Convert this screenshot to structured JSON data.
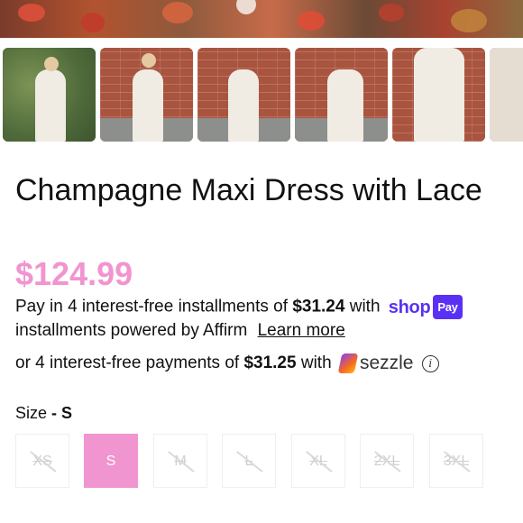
{
  "product": {
    "title": "Champagne Maxi Dress with Lace",
    "price": "$124.99"
  },
  "shop_pay": {
    "line_start": "Pay in 4 interest-free installments of",
    "amount": "$31.24",
    "with": "with",
    "logo_text": "shop",
    "pill_text": "Pay",
    "line_end": "installments powered by Affirm",
    "learn_more": "Learn more"
  },
  "sezzle": {
    "line_start": "or 4 interest-free payments of",
    "amount": "$31.25",
    "with": "with",
    "logo_text": "sezzle",
    "info_glyph": "i"
  },
  "size": {
    "label": "Size",
    "separator": "-",
    "selected": "S",
    "options": [
      "XS",
      "S",
      "M",
      "L",
      "XL",
      "2XL",
      "3XL"
    ],
    "available": [
      false,
      true,
      false,
      false,
      false,
      false,
      false
    ]
  },
  "colors": {
    "accent_pink": "#f095cf",
    "shop_purple": "#5a31f4"
  }
}
